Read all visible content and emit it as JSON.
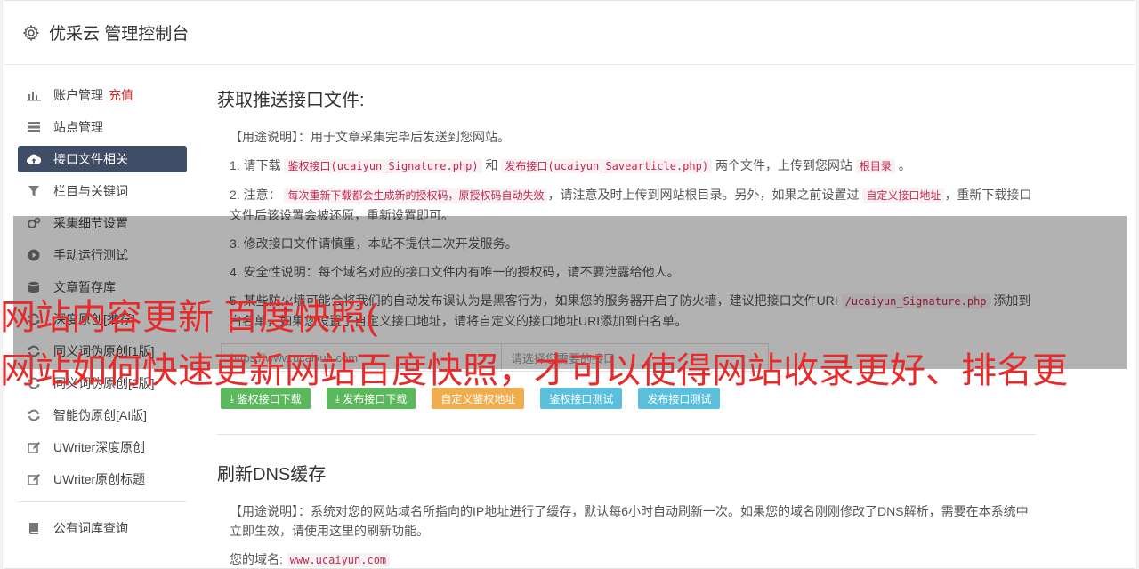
{
  "header": {
    "title": "优采云 管理控制台",
    "icon": "gear-icon"
  },
  "sidebar": {
    "items": [
      {
        "label": "账户管理",
        "badge": "充值",
        "icon": "bar-chart-icon"
      },
      {
        "label": "站点管理",
        "icon": "server-icon"
      },
      {
        "label": "接口文件相关",
        "icon": "cloud-upload-icon",
        "active": true
      },
      {
        "label": "栏目与关键词",
        "icon": "filter-icon"
      },
      {
        "label": "采集细节设置",
        "icon": "cogs-icon"
      },
      {
        "label": "手动运行测试",
        "icon": "play-circle-icon"
      },
      {
        "label": "文章暂存库",
        "icon": "database-icon"
      },
      {
        "label": "深度原创[推荐]",
        "icon": "refresh-icon"
      },
      {
        "label": "同义词伪原创[1版]",
        "icon": "refresh-icon"
      },
      {
        "label": "同义词伪原创[2版]",
        "icon": "refresh-icon"
      },
      {
        "label": "智能伪原创[AI版]",
        "icon": "refresh-icon"
      },
      {
        "label": "UWriter深度原创",
        "icon": "edit-icon"
      },
      {
        "label": "UWriter原创标题",
        "icon": "edit-icon"
      },
      {
        "label": "公有词库查询",
        "icon": "book-icon"
      }
    ]
  },
  "section1": {
    "title": "获取推送接口文件:",
    "usage_label": "【用途说明】",
    "usage_text": "：用于文章采集完毕后发送到您网站。",
    "step1_a": "1. 请下载",
    "step1_code1": "鉴权接口(ucaiyun_Signature.php)",
    "step1_b": "和",
    "step1_code2": "发布接口(ucaiyun_Savearticle.php)",
    "step1_c": "两个文件，上传到您网站",
    "step1_code3": "根目录",
    "step1_d": "。",
    "step2_a": "2. 注意：",
    "step2_code1": "每次重新下载都会生成新的授权码，原授权码自动失效",
    "step2_b": "，请注意及时上传到网站根目录。另外，如果之前设置过",
    "step2_code2": "自定义接口地址",
    "step2_c": "，重新下载接口文件后该设置会被还原，重新设置即可。",
    "step3": "3. 修改接口文件请慎重，本站不提供二次开发服务。",
    "step4": "4. 安全性说明：每个域名对应的接口文件内有唯一的授权码，请不要泄露给他人。",
    "step5_a": "5. 某些防火墙可能会将我们的自动发布误认为是黑客行为，如果您的服务器开启了防火墙，建议把接口文件URI",
    "step5_code": "/ucaiyun_Signature.php",
    "step5_b": "添加到白名单，如果您设置了自定义接口地址，请将自定义的接口地址URI添加到白名单。",
    "site_input": "https://www.ucaiyun.com",
    "select_placeholder": "请选择您需要的接口",
    "buttons": {
      "sign_download": "鉴权接口下载",
      "publish_download": "发布接口下载",
      "custom_sign": "自定义鉴权地址",
      "sign_test": "鉴权接口测试",
      "publish_test": "发布接口测试"
    }
  },
  "section2": {
    "title": "刷新DNS缓存",
    "usage_label": "【用途说明】",
    "usage_text": "：系统对您的网站域名所指向的IP地址进行了缓存，默认每6小时自动刷新一次。如果您的域名刚刚修改了DNS解析，需要在本系统中立即生效，请使用这里的刷新功能。",
    "domain_label": "您的域名:",
    "domain_value": "www.ucaiyun.com"
  },
  "captions": {
    "line1": "网站内容更新 百度快照(",
    "line2": "网站如何快速更新网站百度快照，才可以使得网站收录更好、排名更"
  },
  "colors": {
    "active_nav": "#3f4d66",
    "red": "#e0272e",
    "green": "#5cb85c",
    "orange": "#f0ad4e",
    "blue": "#5bc0de"
  }
}
